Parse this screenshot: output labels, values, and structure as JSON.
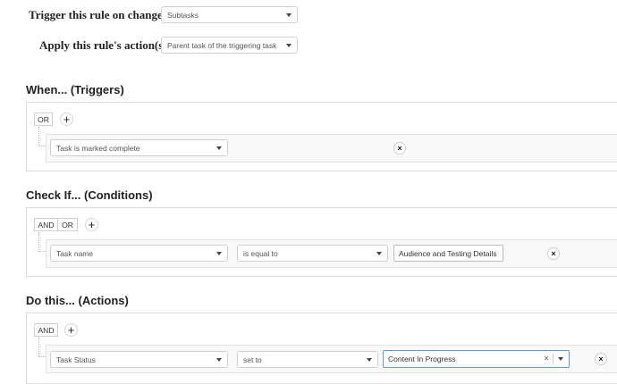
{
  "header": {
    "trigger_label": "Trigger this rule on changes to:",
    "trigger_value": "Subtasks",
    "apply_label": "Apply this rule's action(s) to:",
    "apply_value": "Parent task of the triggering task"
  },
  "triggers": {
    "title": "When... (Triggers)",
    "op": "OR",
    "add": "+",
    "row": {
      "field": "Task is marked complete",
      "remove": "×"
    }
  },
  "conditions": {
    "title": "Check If... (Conditions)",
    "op_and": "AND",
    "op_or": "OR",
    "add": "+",
    "row": {
      "field": "Task name",
      "operator": "is equal to",
      "value": "Audience and Testing Details",
      "remove": "×"
    }
  },
  "actions": {
    "title": "Do this... (Actions)",
    "op": "AND",
    "add": "+",
    "row": {
      "field": "Task Status",
      "operator": "set to",
      "value": "Content In Progress",
      "clear": "×",
      "remove": "×"
    }
  }
}
